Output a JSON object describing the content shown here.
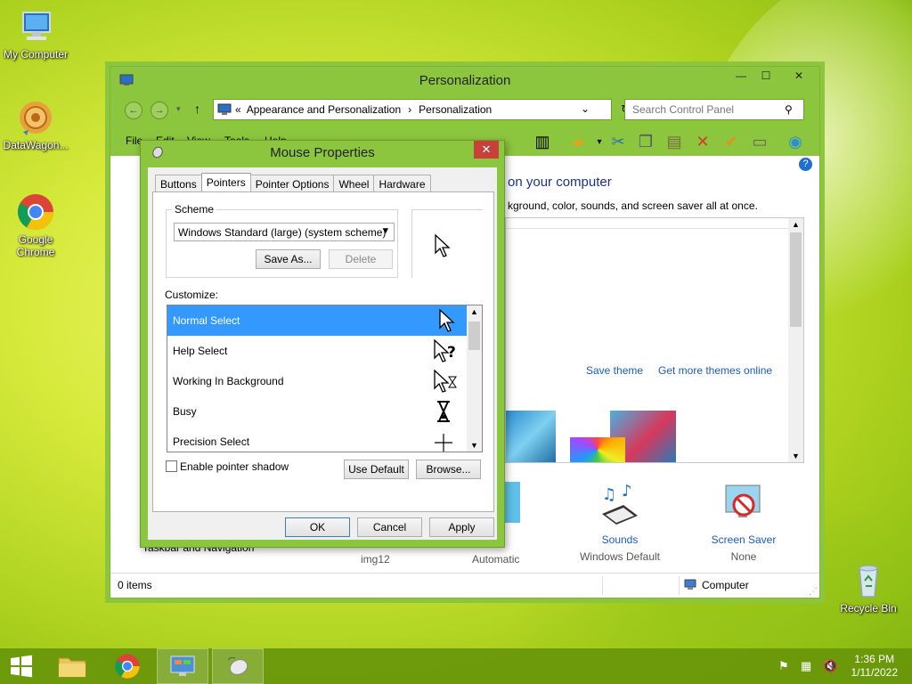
{
  "desktop": {
    "icons": [
      {
        "label": "My Computer"
      },
      {
        "label": "DataWagon..."
      },
      {
        "label": "Google Chrome"
      },
      {
        "label": "Recycle Bin"
      }
    ]
  },
  "explorer": {
    "title": "Personalization",
    "address": {
      "prefix": "«",
      "crumb1": "Appearance and Personalization",
      "sep": "›",
      "crumb2": "Personalization"
    },
    "search_placeholder": "Search Control Panel",
    "menu": [
      "File",
      "Edit",
      "View",
      "Tools",
      "Help"
    ],
    "heading": "on your computer",
    "subheading": "kground, color, sounds, and screen saver all at once.",
    "links": {
      "save_theme": "Save theme",
      "get_more": "Get more themes online"
    },
    "bottom": {
      "taskbar_nav": "Taskbar and Navigation",
      "background_value": "img12",
      "color_value": "Automatic",
      "sounds_label": "Sounds",
      "sounds_value": "Windows Default",
      "screensaver_label": "Screen Saver",
      "screensaver_value": "None"
    },
    "status": {
      "items": "0 items",
      "location": "Computer"
    }
  },
  "dialog": {
    "title": "Mouse Properties",
    "tabs": [
      "Buttons",
      "Pointers",
      "Pointer Options",
      "Wheel",
      "Hardware"
    ],
    "active_tab": "Pointers",
    "scheme_label": "Scheme",
    "scheme_value": "Windows Standard (large) (system scheme)",
    "save_as": "Save As...",
    "delete": "Delete",
    "customize_label": "Customize:",
    "list_items": [
      "Normal Select",
      "Help Select",
      "Working In Background",
      "Busy",
      "Precision Select"
    ],
    "shadow_label": "Enable pointer shadow",
    "use_default": "Use Default",
    "browse": "Browse...",
    "ok": "OK",
    "cancel": "Cancel",
    "apply": "Apply"
  },
  "taskbar": {
    "time": "1:36 PM",
    "date": "1/11/2022"
  }
}
